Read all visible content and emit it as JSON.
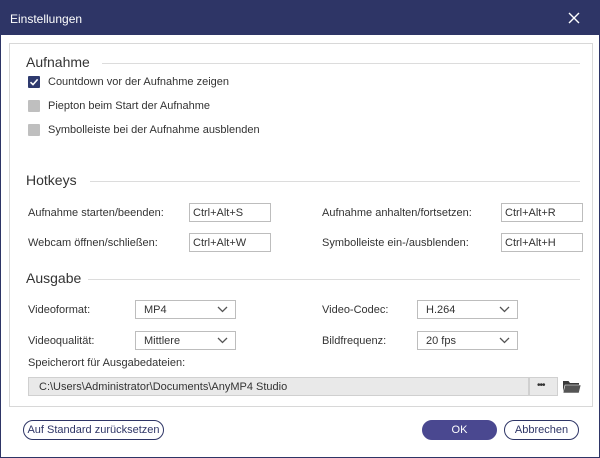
{
  "window": {
    "title": "Einstellungen"
  },
  "aufnahme": {
    "title": "Aufnahme",
    "options": [
      {
        "label": "Countdown vor der Aufnahme zeigen",
        "checked": true
      },
      {
        "label": "Piepton beim Start der Aufnahme",
        "checked": false
      },
      {
        "label": "Symbolleiste bei der Aufnahme ausblenden",
        "checked": false
      }
    ]
  },
  "hotkeys": {
    "title": "Hotkeys",
    "items": [
      {
        "label": "Aufnahme starten/beenden:",
        "value": "Ctrl+Alt+S"
      },
      {
        "label": "Aufnahme anhalten/fortsetzen:",
        "value": "Ctrl+Alt+R"
      },
      {
        "label": "Webcam öffnen/schließen:",
        "value": "Ctrl+Alt+W"
      },
      {
        "label": "Symbolleiste ein-/ausblenden:",
        "value": "Ctrl+Alt+H"
      }
    ]
  },
  "ausgabe": {
    "title": "Ausgabe",
    "videoformat": {
      "label": "Videoformat:",
      "value": "MP4"
    },
    "videocodec": {
      "label": "Video-Codec:",
      "value": "H.264"
    },
    "videoqualitaet": {
      "label": "Videoqualität:",
      "value": "Mittlere"
    },
    "bildfrequenz": {
      "label": "Bildfrequenz:",
      "value": "20 fps"
    },
    "speicherort": {
      "label": "Speicherort für Ausgabedateien:",
      "path": "C:\\Users\\Administrator\\Documents\\AnyMP4 Studio",
      "browse_label": "•••"
    }
  },
  "buttons": {
    "reset": "Auf Standard zurücksetzen",
    "ok": "OK",
    "cancel": "Abbrechen"
  },
  "colors": {
    "titlebar": "#2e3566",
    "checkbox_checked": "#2e3a6e",
    "checkbox_unchecked": "#bfbfbf",
    "primary_button": "#4a4890"
  }
}
